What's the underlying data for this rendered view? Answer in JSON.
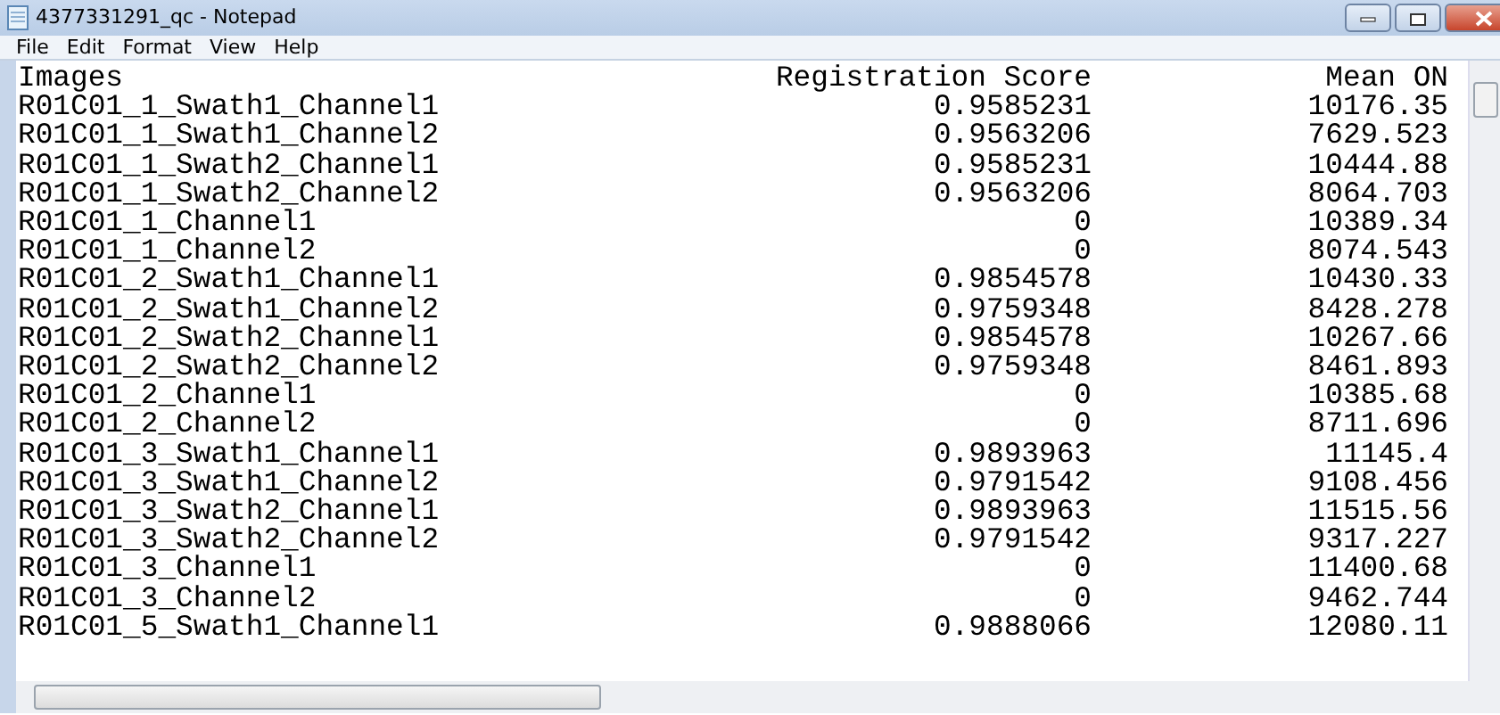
{
  "window": {
    "title": "4377331291_qc - Notepad"
  },
  "menu": [
    "File",
    "Edit",
    "Format",
    "View",
    "Help"
  ],
  "columns": [
    "Images",
    "Registration Score",
    "Mean ON"
  ],
  "rows": [
    {
      "image": "R01C01_1_Swath1_Channel1",
      "registration_score": "0.9585231",
      "mean_on": "10176.35"
    },
    {
      "image": "R01C01_1_Swath1_Channel2",
      "registration_score": "0.9563206",
      "mean_on": "7629.523"
    },
    {
      "image": "R01C01_1_Swath2_Channel1",
      "registration_score": "0.9585231",
      "mean_on": "10444.88"
    },
    {
      "image": "R01C01_1_Swath2_Channel2",
      "registration_score": "0.9563206",
      "mean_on": "8064.703"
    },
    {
      "image": "R01C01_1_Channel1",
      "registration_score": "0",
      "mean_on": "10389.34"
    },
    {
      "image": "R01C01_1_Channel2",
      "registration_score": "0",
      "mean_on": "8074.543"
    },
    {
      "image": "R01C01_2_Swath1_Channel1",
      "registration_score": "0.9854578",
      "mean_on": "10430.33"
    },
    {
      "image": "R01C01_2_Swath1_Channel2",
      "registration_score": "0.9759348",
      "mean_on": "8428.278"
    },
    {
      "image": "R01C01_2_Swath2_Channel1",
      "registration_score": "0.9854578",
      "mean_on": "10267.66"
    },
    {
      "image": "R01C01_2_Swath2_Channel2",
      "registration_score": "0.9759348",
      "mean_on": "8461.893"
    },
    {
      "image": "R01C01_2_Channel1",
      "registration_score": "0",
      "mean_on": "10385.68"
    },
    {
      "image": "R01C01_2_Channel2",
      "registration_score": "0",
      "mean_on": "8711.696"
    },
    {
      "image": "R01C01_3_Swath1_Channel1",
      "registration_score": "0.9893963",
      "mean_on": "11145.4"
    },
    {
      "image": "R01C01_3_Swath1_Channel2",
      "registration_score": "0.9791542",
      "mean_on": "9108.456"
    },
    {
      "image": "R01C01_3_Swath2_Channel1",
      "registration_score": "0.9893963",
      "mean_on": "11515.56"
    },
    {
      "image": "R01C01_3_Swath2_Channel2",
      "registration_score": "0.9791542",
      "mean_on": "9317.227"
    },
    {
      "image": "R01C01_3_Channel1",
      "registration_score": "0",
      "mean_on": "11400.68"
    },
    {
      "image": "R01C01_3_Channel2",
      "registration_score": "0",
      "mean_on": "9462.744"
    },
    {
      "image": "R01C01_5_Swath1_Channel1",
      "registration_score": "0.9888066",
      "mean_on": "12080.11"
    }
  ]
}
